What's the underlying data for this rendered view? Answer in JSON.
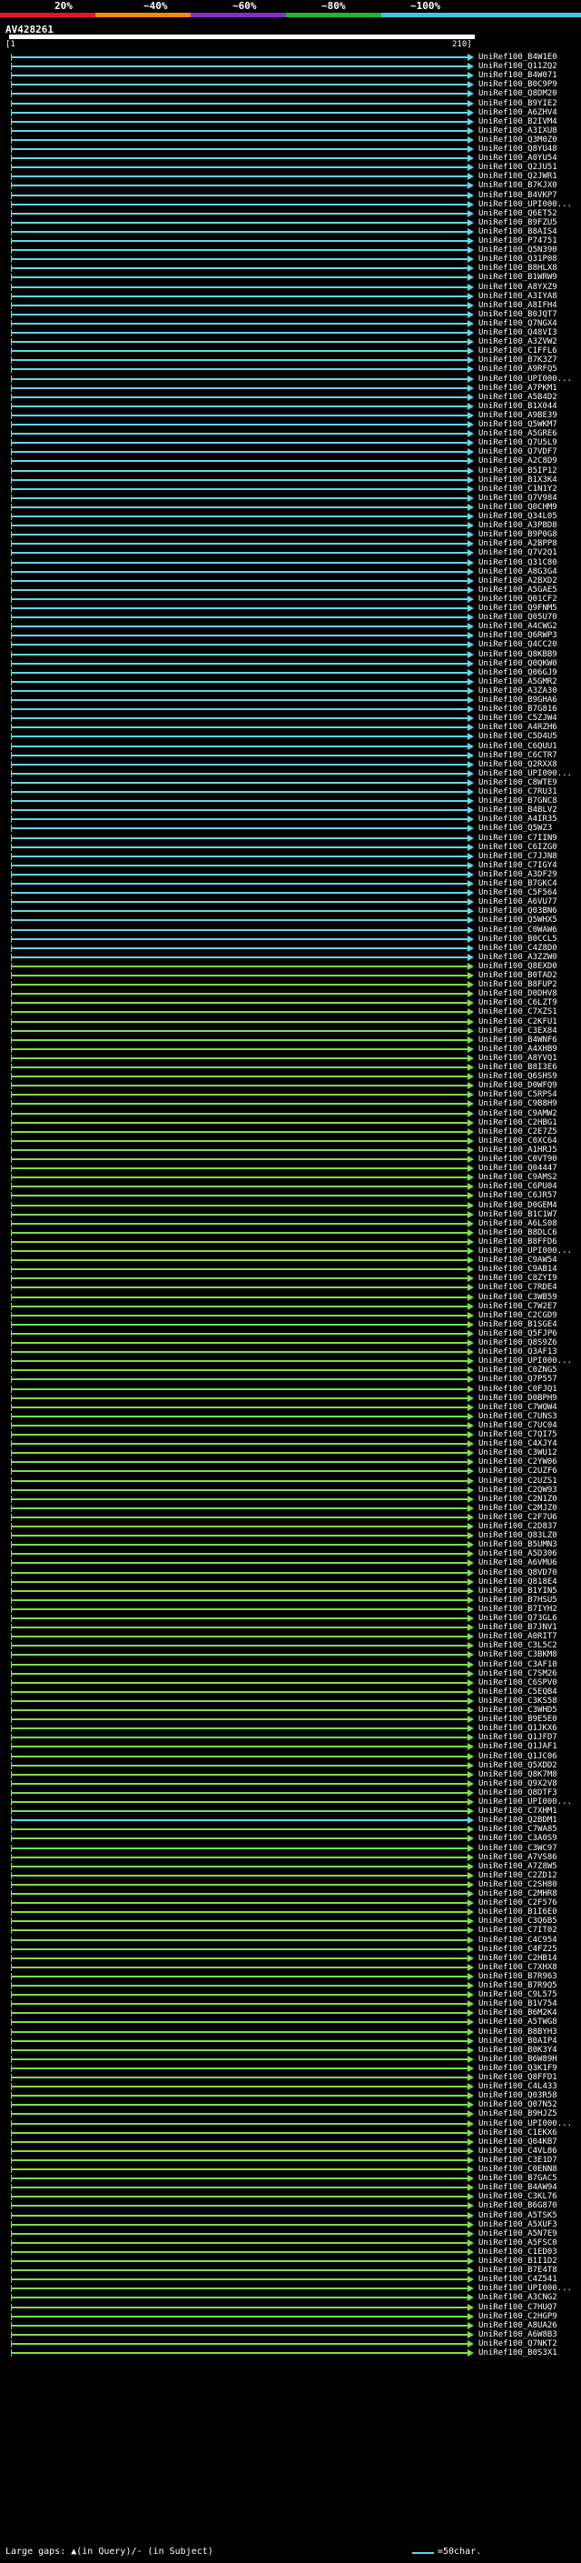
{
  "scale": {
    "labels": [
      "20%",
      "~40%",
      "~60%",
      "~80%",
      "~100%"
    ],
    "colors": [
      "#e8102a",
      "#f08a10",
      "#8a2cc8",
      "#1cb82c",
      "#3cc8e0"
    ]
  },
  "query": {
    "name": "AV428261",
    "start_tick": "[1",
    "end_tick": "210]"
  },
  "colors": {
    "cyan": "#5fd8e8",
    "green": "#7ae04a"
  },
  "legend": {
    "gaps_text": "Large gaps: ▲(in Query)/- (in Subject)",
    "sample_text": "=50char."
  },
  "hits": [
    {
      "label": "UniRef100_B4W1E0",
      "c": "c"
    },
    {
      "label": "UniRef100_Q11ZQ2",
      "c": "c"
    },
    {
      "label": "UniRef100_B4W071",
      "c": "c"
    },
    {
      "label": "UniRef100_B0C9P9",
      "c": "c"
    },
    {
      "label": "UniRef100_Q8DM20",
      "c": "c"
    },
    {
      "label": "UniRef100_B9YIE2",
      "c": "c"
    },
    {
      "label": "UniRef100_A6ZHV4",
      "c": "c"
    },
    {
      "label": "UniRef100_B2IVM4",
      "c": "c"
    },
    {
      "label": "UniRef100_A3IXU8",
      "c": "c"
    },
    {
      "label": "UniRef100_Q3M0Z0",
      "c": "c"
    },
    {
      "label": "UniRef100_Q8YU48",
      "c": "c"
    },
    {
      "label": "UniRef100_A0YU54",
      "c": "c"
    },
    {
      "label": "UniRef100_Q2JU51",
      "c": "c"
    },
    {
      "label": "UniRef100_Q2JWR1",
      "c": "c"
    },
    {
      "label": "UniRef100_B7KJX0",
      "c": "c"
    },
    {
      "label": "UniRef100_B4VKP7",
      "c": "c"
    },
    {
      "label": "UniRef100_UPI000...",
      "c": "c"
    },
    {
      "label": "UniRef100_Q6ET52",
      "c": "c"
    },
    {
      "label": "UniRef100_B9FZU5",
      "c": "c"
    },
    {
      "label": "UniRef100_B8AIS4",
      "c": "c"
    },
    {
      "label": "UniRef100_P74751",
      "c": "c"
    },
    {
      "label": "UniRef100_Q5N390",
      "c": "c"
    },
    {
      "label": "UniRef100_Q31P08",
      "c": "c"
    },
    {
      "label": "UniRef100_B8HLX8",
      "c": "c"
    },
    {
      "label": "UniRef100_B1WRW9",
      "c": "c"
    },
    {
      "label": "UniRef100_A8YXZ9",
      "c": "c"
    },
    {
      "label": "UniRef100_A3IYA8",
      "c": "c"
    },
    {
      "label": "UniRef100_A8IFH4",
      "c": "c"
    },
    {
      "label": "UniRef100_B0JQT7",
      "c": "c"
    },
    {
      "label": "UniRef100_Q7NGX4",
      "c": "c"
    },
    {
      "label": "UniRef100_Q48VI3",
      "c": "c"
    },
    {
      "label": "UniRef100_A3ZVW2",
      "c": "c"
    },
    {
      "label": "UniRef100_C1FFL6",
      "c": "c"
    },
    {
      "label": "UniRef100_B7K3Z7",
      "c": "c"
    },
    {
      "label": "UniRef100_A9RFQ5",
      "c": "c"
    },
    {
      "label": "UniRef100_UPI000...",
      "c": "c"
    },
    {
      "label": "UniRef100_A7PKM1",
      "c": "c"
    },
    {
      "label": "UniRef100_A5B4D2",
      "c": "c"
    },
    {
      "label": "UniRef100_B1X044",
      "c": "c"
    },
    {
      "label": "UniRef100_A9BE39",
      "c": "c"
    },
    {
      "label": "UniRef100_Q5WKM7",
      "c": "c"
    },
    {
      "label": "UniRef100_A5GRE6",
      "c": "c"
    },
    {
      "label": "UniRef100_Q7U5L9",
      "c": "c"
    },
    {
      "label": "UniRef100_Q7VDF7",
      "c": "c"
    },
    {
      "label": "UniRef100_A2C8D9",
      "c": "c"
    },
    {
      "label": "UniRef100_B5IP12",
      "c": "c"
    },
    {
      "label": "UniRef100_B1X3K4",
      "c": "c"
    },
    {
      "label": "UniRef100_C1N1Y2",
      "c": "c"
    },
    {
      "label": "UniRef100_Q7V984",
      "c": "c"
    },
    {
      "label": "UniRef100_Q0CHM9",
      "c": "c"
    },
    {
      "label": "UniRef100_Q34L05",
      "c": "c"
    },
    {
      "label": "UniRef100_A3PBD8",
      "c": "c"
    },
    {
      "label": "UniRef100_B9P0G8",
      "c": "c"
    },
    {
      "label": "UniRef100_A2BPP8",
      "c": "c"
    },
    {
      "label": "UniRef100_Q7V2Q1",
      "c": "c"
    },
    {
      "label": "UniRef100_Q31C80",
      "c": "c"
    },
    {
      "label": "UniRef100_A8G3G4",
      "c": "c"
    },
    {
      "label": "UniRef100_A2BXD2",
      "c": "c"
    },
    {
      "label": "UniRef100_A5GAE5",
      "c": "c"
    },
    {
      "label": "UniRef100_Q01CF2",
      "c": "c"
    },
    {
      "label": "UniRef100_Q9FNM5",
      "c": "c"
    },
    {
      "label": "UniRef100_Q05U70",
      "c": "c"
    },
    {
      "label": "UniRef100_A4CWG2",
      "c": "c"
    },
    {
      "label": "UniRef100_Q6RWP3",
      "c": "c"
    },
    {
      "label": "UniRef100_Q4CC20",
      "c": "c"
    },
    {
      "label": "UniRef100_Q8KBB9",
      "c": "c"
    },
    {
      "label": "UniRef100_Q0QKW0",
      "c": "c"
    },
    {
      "label": "UniRef100_Q06GJ9",
      "c": "c"
    },
    {
      "label": "UniRef100_A5GMR2",
      "c": "c"
    },
    {
      "label": "UniRef100_A3ZA30",
      "c": "c"
    },
    {
      "label": "UniRef100_B9GHA6",
      "c": "c"
    },
    {
      "label": "UniRef100_B7G816",
      "c": "c"
    },
    {
      "label": "UniRef100_C5ZJW4",
      "c": "c"
    },
    {
      "label": "UniRef100_A4RZH6",
      "c": "c"
    },
    {
      "label": "UniRef100_C5D4U5",
      "c": "c"
    },
    {
      "label": "UniRef100_C6QUU1",
      "c": "c"
    },
    {
      "label": "UniRef100_C6CTR7",
      "c": "c"
    },
    {
      "label": "UniRef100_Q2RXX8",
      "c": "c"
    },
    {
      "label": "UniRef100_UPI000...",
      "c": "c"
    },
    {
      "label": "UniRef100_C8WTE9",
      "c": "c"
    },
    {
      "label": "UniRef100_C7RU31",
      "c": "c"
    },
    {
      "label": "UniRef100_B7GNC8",
      "c": "c"
    },
    {
      "label": "UniRef100_B4BLV2",
      "c": "c"
    },
    {
      "label": "UniRef100_A4IR35",
      "c": "c"
    },
    {
      "label": "UniRef100_Q5WZ3",
      "c": "c"
    },
    {
      "label": "UniRef100_C7IIN9",
      "c": "c"
    },
    {
      "label": "UniRef100_C6IZG0",
      "c": "c"
    },
    {
      "label": "UniRef100_C7JJN8",
      "c": "c"
    },
    {
      "label": "UniRef100_C7IGY4",
      "c": "c"
    },
    {
      "label": "UniRef100_A3DF29",
      "c": "c"
    },
    {
      "label": "UniRef100_B7GKC4",
      "c": "c"
    },
    {
      "label": "UniRef100_C5F564",
      "c": "c"
    },
    {
      "label": "UniRef100_A6VU77",
      "c": "c"
    },
    {
      "label": "UniRef100_Q03BN6",
      "c": "c"
    },
    {
      "label": "UniRef100_Q5WHX5",
      "c": "c"
    },
    {
      "label": "UniRef100_C0WAW6",
      "c": "c"
    },
    {
      "label": "UniRef100_B0CCL5",
      "c": "c"
    },
    {
      "label": "UniRef100_C4Z8D0",
      "c": "c"
    },
    {
      "label": "UniRef100_A3ZZW0",
      "c": "c"
    },
    {
      "label": "UniRef100_Q8EXD0",
      "c": "g"
    },
    {
      "label": "UniRef100_B0TAD2",
      "c": "g"
    },
    {
      "label": "UniRef100_B8FUP2",
      "g": 1,
      "c": "g"
    },
    {
      "label": "UniRef100_D0DHV8",
      "c": "g"
    },
    {
      "label": "UniRef100_C6LZT9",
      "c": "g"
    },
    {
      "label": "UniRef100_C7XZS1",
      "c": "g"
    },
    {
      "label": "UniRef100_C2KFU1",
      "c": "g"
    },
    {
      "label": "UniRef100_C3EX84",
      "c": "g"
    },
    {
      "label": "UniRef100_B4WNF6",
      "c": "g"
    },
    {
      "label": "UniRef100_A4XHB9",
      "c": "g"
    },
    {
      "label": "UniRef100_A8YVQ1",
      "c": "g"
    },
    {
      "label": "UniRef100_B8I3E6",
      "c": "g"
    },
    {
      "label": "UniRef100_Q6SHS9",
      "c": "g"
    },
    {
      "label": "UniRef100_D0WFQ9",
      "c": "g"
    },
    {
      "label": "UniRef100_C5RPS4",
      "c": "g"
    },
    {
      "label": "UniRef100_C9B8H9",
      "c": "g"
    },
    {
      "label": "UniRef100_C9AMW2",
      "c": "g"
    },
    {
      "label": "UniRef100_C2HBG1",
      "c": "g"
    },
    {
      "label": "UniRef100_C2E7Z5",
      "c": "g"
    },
    {
      "label": "UniRef100_C0XC64",
      "c": "g"
    },
    {
      "label": "UniRef100_A1HRJ5",
      "c": "g"
    },
    {
      "label": "UniRef100_C0VT90",
      "c": "g"
    },
    {
      "label": "UniRef100_Q04447",
      "c": "g"
    },
    {
      "label": "UniRef100_C9AMS2",
      "c": "g"
    },
    {
      "label": "UniRef100_C6PU04",
      "c": "g"
    },
    {
      "label": "UniRef100_C6JR57",
      "c": "g"
    },
    {
      "label": "UniRef100_D0GEM4",
      "c": "g"
    },
    {
      "label": "UniRef100_B1C1W7",
      "c": "g"
    },
    {
      "label": "UniRef100_A6LS08",
      "c": "g"
    },
    {
      "label": "UniRef100_B8DLC6",
      "c": "g"
    },
    {
      "label": "UniRef100_B8FFD6",
      "c": "g"
    },
    {
      "label": "UniRef100_UPI000...",
      "c": "g"
    },
    {
      "label": "UniRef100_C9AW54",
      "c": "g"
    },
    {
      "label": "UniRef100_C9AB14",
      "c": "g"
    },
    {
      "label": "UniRef100_C8ZYI9",
      "c": "g"
    },
    {
      "label": "UniRef100_C7RDE4",
      "c": "g"
    },
    {
      "label": "UniRef100_C3WB59",
      "c": "g"
    },
    {
      "label": "UniRef100_C7W2E7",
      "c": "g"
    },
    {
      "label": "UniRef100_C2CGD9",
      "c": "g"
    },
    {
      "label": "UniRef100_B1SGE4",
      "c": "g"
    },
    {
      "label": "UniRef100_Q5FJP6",
      "c": "g"
    },
    {
      "label": "UniRef100_Q8S9Z6",
      "c": "g"
    },
    {
      "label": "UniRef100_Q3AF13",
      "c": "g"
    },
    {
      "label": "UniRef100_UPI000...",
      "c": "g"
    },
    {
      "label": "UniRef100_C0ZNG5",
      "c": "g"
    },
    {
      "label": "UniRef100_Q7P557",
      "c": "g"
    },
    {
      "label": "UniRef100_C0FJQ1",
      "c": "g"
    },
    {
      "label": "UniRef100_D0BPH9",
      "c": "g"
    },
    {
      "label": "UniRef100_C7WQW4",
      "c": "g"
    },
    {
      "label": "UniRef100_C7UNS3",
      "c": "g"
    },
    {
      "label": "UniRef100_C7UC04",
      "c": "g"
    },
    {
      "label": "UniRef100_C7QI75",
      "c": "g"
    },
    {
      "label": "UniRef100_C4XJY4",
      "c": "g"
    },
    {
      "label": "UniRef100_C3WU12",
      "c": "g"
    },
    {
      "label": "UniRef100_C2YW06",
      "c": "g"
    },
    {
      "label": "UniRef100_C2UZF6",
      "c": "g"
    },
    {
      "label": "UniRef100_C2UZS1",
      "c": "g"
    },
    {
      "label": "UniRef100_C2QW93",
      "c": "g"
    },
    {
      "label": "UniRef100_C2N1Z0",
      "c": "g"
    },
    {
      "label": "UniRef100_C2MJZ0",
      "c": "g"
    },
    {
      "label": "UniRef100_C2F7U6",
      "c": "g"
    },
    {
      "label": "UniRef100_C2D837",
      "c": "g"
    },
    {
      "label": "UniRef100_Q83LZ0",
      "c": "g"
    },
    {
      "label": "UniRef100_B5UMN3",
      "c": "g"
    },
    {
      "label": "UniRef100_A5D306",
      "c": "g"
    },
    {
      "label": "UniRef100_A6VMU6",
      "c": "g"
    },
    {
      "label": "UniRef100_Q8VD70",
      "c": "g"
    },
    {
      "label": "UniRef100_Q818E4",
      "c": "g"
    },
    {
      "label": "UniRef100_B1YIN5",
      "c": "g"
    },
    {
      "label": "UniRef100_B7HSU5",
      "c": "g"
    },
    {
      "label": "UniRef100_B7IYH2",
      "c": "g"
    },
    {
      "label": "UniRef100_Q73GL6",
      "c": "g"
    },
    {
      "label": "UniRef100_B7JNV1",
      "c": "g"
    },
    {
      "label": "UniRef100_A0RIT7",
      "c": "g"
    },
    {
      "label": "UniRef100_C3L5C2",
      "c": "g"
    },
    {
      "label": "UniRef100_C3BKM8",
      "c": "g"
    },
    {
      "label": "UniRef100_C3AF10",
      "c": "g"
    },
    {
      "label": "UniRef100_C7SM26",
      "c": "g"
    },
    {
      "label": "UniRef100_C6SPV0",
      "c": "g"
    },
    {
      "label": "UniRef100_C5EQB4",
      "c": "g"
    },
    {
      "label": "UniRef100_C3KS58",
      "c": "g"
    },
    {
      "label": "UniRef100_C3WHD5",
      "c": "g"
    },
    {
      "label": "UniRef100_B9E5E0",
      "c": "g"
    },
    {
      "label": "UniRef100_Q1JKX6",
      "c": "g"
    },
    {
      "label": "UniRef100_Q1JFD7",
      "c": "g"
    },
    {
      "label": "UniRef100_Q1JAF1",
      "c": "g"
    },
    {
      "label": "UniRef100_Q1JC06",
      "c": "g"
    },
    {
      "label": "UniRef100_Q5XDD2",
      "c": "g"
    },
    {
      "label": "UniRef100_Q8K7M8",
      "c": "g"
    },
    {
      "label": "UniRef100_Q9X2V8",
      "c": "g"
    },
    {
      "label": "UniRef100_Q8DTF3",
      "c": "g"
    },
    {
      "label": "UniRef100_UPI000...",
      "c": "g"
    },
    {
      "label": "UniRef100_C7XHM1",
      "c": "g"
    },
    {
      "label": "UniRef100_Q2BDM1",
      "c": "c"
    },
    {
      "label": "UniRef100_C7WA85",
      "c": "g"
    },
    {
      "label": "UniRef100_C3A0S9",
      "c": "g"
    },
    {
      "label": "UniRef100_C3WC97",
      "c": "g"
    },
    {
      "label": "UniRef100_A7VS86",
      "c": "g"
    },
    {
      "label": "UniRef100_A7Z8W5",
      "c": "g"
    },
    {
      "label": "UniRef100_C2ZD12",
      "c": "g"
    },
    {
      "label": "UniRef100_C2SH80",
      "c": "g"
    },
    {
      "label": "UniRef100_C2MHR8",
      "c": "g"
    },
    {
      "label": "UniRef100_C2F576",
      "c": "g"
    },
    {
      "label": "UniRef100_B1I6E0",
      "c": "g"
    },
    {
      "label": "UniRef100_C3Q6B5",
      "c": "g"
    },
    {
      "label": "UniRef100_C7IT02",
      "c": "g"
    },
    {
      "label": "UniRef100_C4C954",
      "c": "g"
    },
    {
      "label": "UniRef100_C4FZ25",
      "c": "g"
    },
    {
      "label": "UniRef100_C2HB14",
      "c": "g"
    },
    {
      "label": "UniRef100_C7XHX8",
      "c": "g"
    },
    {
      "label": "UniRef100_B7R963",
      "c": "g"
    },
    {
      "label": "UniRef100_B7R9Q5",
      "c": "g"
    },
    {
      "label": "UniRef100_C9L575",
      "c": "g"
    },
    {
      "label": "UniRef100_B1V754",
      "c": "g"
    },
    {
      "label": "UniRef100_B6M2K4",
      "c": "g"
    },
    {
      "label": "UniRef100_A5TWG8",
      "c": "g"
    },
    {
      "label": "UniRef100_B8BYH3",
      "c": "g"
    },
    {
      "label": "UniRef100_B0AIP4",
      "c": "g"
    },
    {
      "label": "UniRef100_B0K3Y4",
      "c": "g"
    },
    {
      "label": "UniRef100_B6W89H",
      "c": "g"
    },
    {
      "label": "UniRef100_Q3K1F9",
      "c": "g"
    },
    {
      "label": "UniRef100_Q8FFD1",
      "c": "g"
    },
    {
      "label": "UniRef100_C4L433",
      "c": "g"
    },
    {
      "label": "UniRef100_Q03R58",
      "c": "g"
    },
    {
      "label": "UniRef100_Q07N52",
      "c": "g"
    },
    {
      "label": "UniRef100_B9HJZ5",
      "c": "g"
    },
    {
      "label": "UniRef100_UPI000...",
      "c": "g"
    },
    {
      "label": "UniRef100_C1EKX6",
      "c": "g"
    },
    {
      "label": "UniRef100_Q04KB7",
      "c": "g"
    },
    {
      "label": "UniRef100_C4VL86",
      "c": "g"
    },
    {
      "label": "UniRef100_C3E1D7",
      "c": "g"
    },
    {
      "label": "UniRef100_C0ENN8",
      "c": "g"
    },
    {
      "label": "UniRef100_B7GAC5",
      "c": "g"
    },
    {
      "label": "UniRef100_B4AW94",
      "c": "g"
    },
    {
      "label": "UniRef100_C3KL76",
      "c": "g"
    },
    {
      "label": "UniRef100_B6G870",
      "c": "g"
    },
    {
      "label": "UniRef100_A5TSK5",
      "c": "g"
    },
    {
      "label": "UniRef100_A5XUF3",
      "c": "g"
    },
    {
      "label": "UniRef100_A5N7E9",
      "c": "g"
    },
    {
      "label": "UniRef100_A5FSC0",
      "c": "g"
    },
    {
      "label": "UniRef100_C1ED03",
      "c": "g"
    },
    {
      "label": "UniRef100_B1I1D2",
      "c": "g"
    },
    {
      "label": "UniRef100_B7E4T8",
      "c": "g"
    },
    {
      "label": "UniRef100_C4Z541",
      "c": "g"
    },
    {
      "label": "UniRef100_UPI000...",
      "c": "g"
    },
    {
      "label": "UniRef100_A3CNG2",
      "c": "g"
    },
    {
      "label": "UniRef100_C7HUQ7",
      "c": "g"
    },
    {
      "label": "UniRef100_C2HGP9",
      "c": "g"
    },
    {
      "label": "UniRef100_A8UA26",
      "c": "g"
    },
    {
      "label": "UniRef100_A6W8B3",
      "c": "g"
    },
    {
      "label": "UniRef100_Q7NKT2",
      "c": "g"
    },
    {
      "label": "UniRef100_B0S3X1",
      "c": "g"
    }
  ]
}
